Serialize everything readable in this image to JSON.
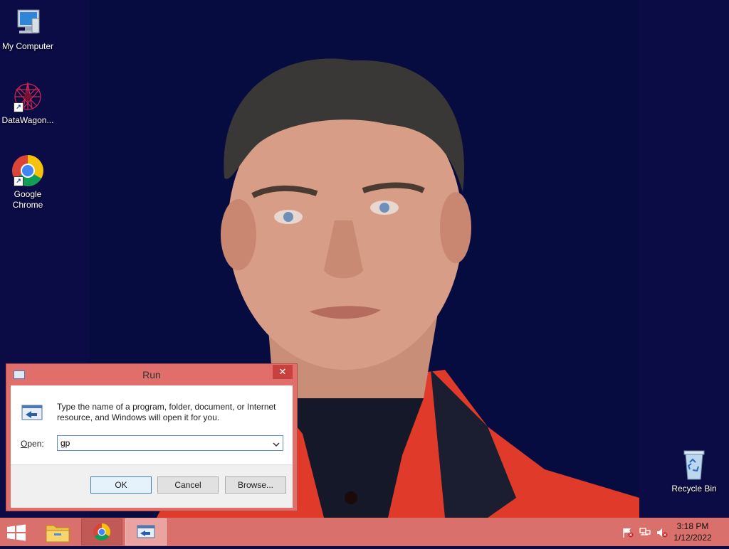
{
  "desktop": {
    "icons": [
      {
        "label": "My Computer",
        "icon": "computer-icon"
      },
      {
        "label": "DataWagon...",
        "icon": "datawagon-icon"
      },
      {
        "label": "Google Chrome",
        "icon": "chrome-icon"
      },
      {
        "label": "Recycle Bin",
        "icon": "recycle-bin-icon"
      }
    ]
  },
  "run_dialog": {
    "title": "Run",
    "close_glyph": "✕",
    "description": "Type the name of a program, folder, document, or Internet resource, and Windows will open it for you.",
    "open_label_prefix": "O",
    "open_label_rest": "pen:",
    "open_value": "gp",
    "ok_label": "OK",
    "cancel_label": "Cancel",
    "browse_label": "Browse..."
  },
  "taskbar": {
    "items": [
      {
        "name": "start",
        "icon": "windows-logo-icon"
      },
      {
        "name": "file-explorer",
        "icon": "folder-icon"
      },
      {
        "name": "google-chrome",
        "icon": "chrome-icon"
      },
      {
        "name": "run",
        "icon": "run-icon",
        "active": true
      }
    ],
    "tray": {
      "icons": [
        "action-center-flag-icon",
        "network-icon",
        "volume-muted-icon"
      ],
      "time": "3:18 PM",
      "date": "1/12/2022"
    }
  },
  "colors": {
    "accent": "#d9706c",
    "wallpaper": "#060b40",
    "desktop": "#0b0b45"
  }
}
